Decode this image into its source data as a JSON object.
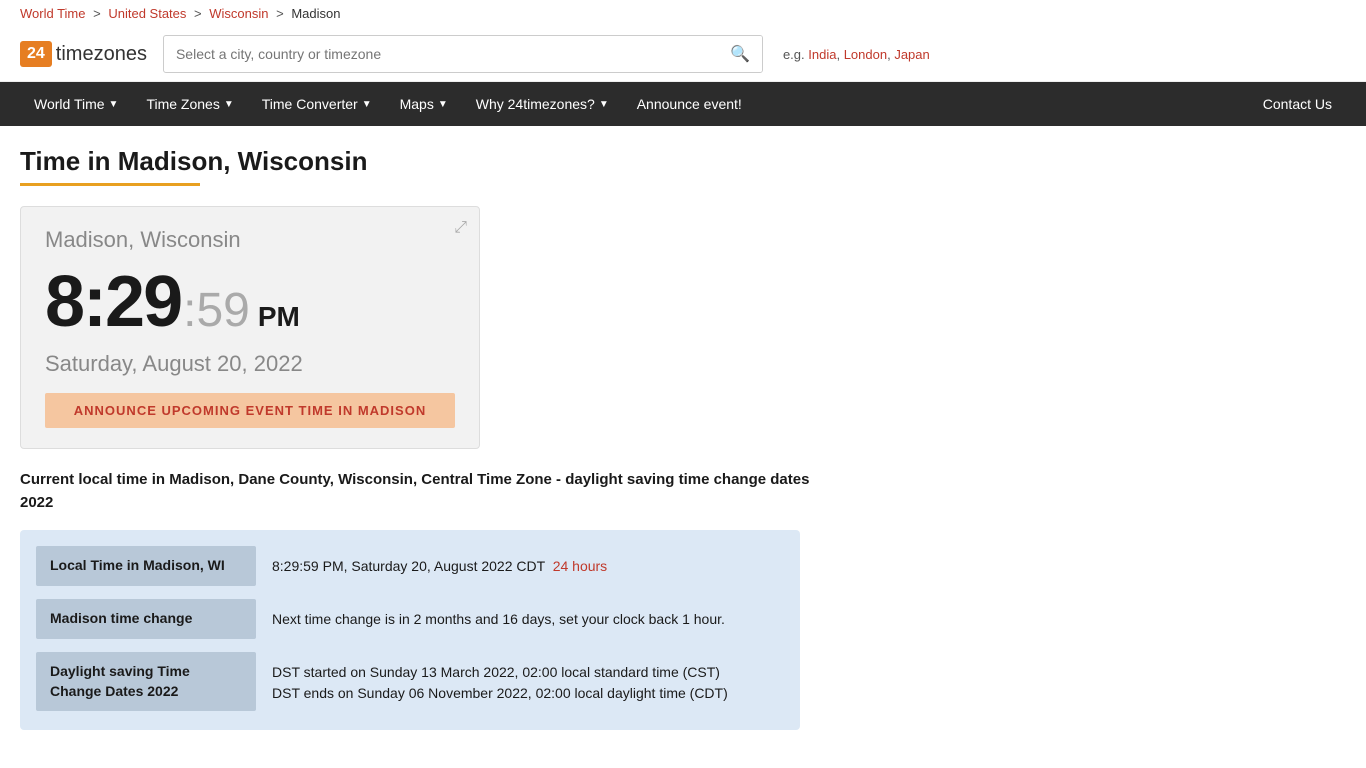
{
  "breadcrumb": {
    "items": [
      {
        "label": "World Time",
        "href": "#"
      },
      {
        "label": "United States",
        "href": "#"
      },
      {
        "label": "Wisconsin",
        "href": "#"
      },
      {
        "label": "Madison",
        "href": null
      }
    ]
  },
  "header": {
    "logo_number": "24",
    "logo_text": "timezones",
    "search_placeholder": "Select a city, country or timezone",
    "examples_label": "e.g.",
    "examples": [
      {
        "label": "India",
        "href": "#"
      },
      {
        "label": "London",
        "href": "#"
      },
      {
        "label": "Japan",
        "href": "#"
      }
    ]
  },
  "nav": {
    "items": [
      {
        "label": "World Time",
        "has_chevron": true
      },
      {
        "label": "Time Zones",
        "has_chevron": true
      },
      {
        "label": "Time Converter",
        "has_chevron": true
      },
      {
        "label": "Maps",
        "has_chevron": true
      },
      {
        "label": "Why 24timezones?",
        "has_chevron": true
      },
      {
        "label": "Announce event!",
        "has_chevron": false
      }
    ],
    "contact_label": "Contact Us"
  },
  "page": {
    "title": "Time in Madison, Wisconsin",
    "clock": {
      "city": "Madison, Wisconsin",
      "hours": "8:29",
      "seconds": "59",
      "ampm": "PM",
      "date": "Saturday, August 20, 2022",
      "announce_btn": "ANNOUNCE UPCOMING EVENT TIME IN MADISON"
    },
    "description": "Current local time in Madison, Dane County, Wisconsin, Central Time Zone - daylight saving time change dates 2022",
    "info_rows": [
      {
        "label": "Local Time in Madison, WI",
        "value": "8:29:59 PM, Saturday 20, August 2022 CDT",
        "link_label": "24 hours",
        "link_href": "#"
      },
      {
        "label": "Madison time change",
        "value": "Next time change is in 2 months and 16 days, set your clock back 1 hour.",
        "link_label": null
      },
      {
        "label": "Daylight saving Time Change Dates 2022",
        "value": "DST started on Sunday 13 March 2022, 02:00 local standard time (CST)\nDST ends on Sunday 06 November 2022, 02:00 local daylight time (CDT)",
        "link_label": null
      }
    ]
  }
}
